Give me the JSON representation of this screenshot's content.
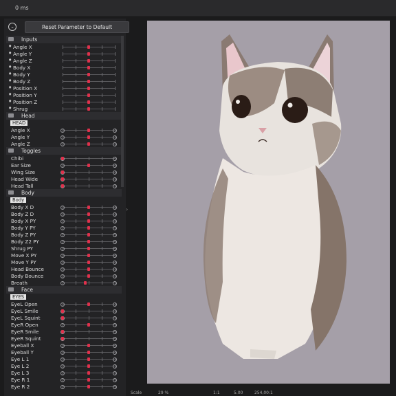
{
  "topbar": {
    "time": "0 ms"
  },
  "toolbar": {
    "reset_label": "Reset Parameter to Default",
    "collapse_icon": "chevron-down-icon"
  },
  "params": [
    {
      "type": "group",
      "label": "Inputs"
    },
    {
      "type": "input",
      "label": "Angle X",
      "value": 0.5
    },
    {
      "type": "input",
      "label": "Angle Y",
      "value": 0.5
    },
    {
      "type": "input",
      "label": "Angle Z",
      "value": 0.5
    },
    {
      "type": "input",
      "label": "Body X",
      "value": 0.5
    },
    {
      "type": "input",
      "label": "Body Y",
      "value": 0.5
    },
    {
      "type": "input",
      "label": "Body Z",
      "value": 0.5
    },
    {
      "type": "input",
      "label": "Position X",
      "value": 0.5
    },
    {
      "type": "input",
      "label": "Position Y",
      "value": 0.5
    },
    {
      "type": "input",
      "label": "Position Z",
      "value": 0.5
    },
    {
      "type": "input",
      "label": "Shrug",
      "value": 0.5
    },
    {
      "type": "group",
      "label": "Head"
    },
    {
      "type": "tag",
      "label": "HEAD"
    },
    {
      "type": "param",
      "label": "Angle X",
      "value": 0.5
    },
    {
      "type": "param",
      "label": "Angle Y",
      "value": 0.5
    },
    {
      "type": "param",
      "label": "Angle Z",
      "value": 0.5
    },
    {
      "type": "group",
      "label": "Toggles"
    },
    {
      "type": "param",
      "label": "Chibi",
      "value": 0.0
    },
    {
      "type": "param",
      "label": "Ear Size",
      "value": 0.5
    },
    {
      "type": "param",
      "label": "Wing Size",
      "value": 0.0
    },
    {
      "type": "param",
      "label": "Head Wide",
      "value": 0.0
    },
    {
      "type": "param",
      "label": "Head Tall",
      "value": 0.0
    },
    {
      "type": "group",
      "label": "Body"
    },
    {
      "type": "tag",
      "label": "Body"
    },
    {
      "type": "param",
      "label": "Body X D",
      "value": 0.5
    },
    {
      "type": "param",
      "label": "Body Z D",
      "value": 0.5
    },
    {
      "type": "param",
      "label": "Body X PY",
      "value": 0.5
    },
    {
      "type": "param",
      "label": "Body Y PY",
      "value": 0.5
    },
    {
      "type": "param",
      "label": "Body Z PY",
      "value": 0.5
    },
    {
      "type": "param",
      "label": "Body Z2 PY",
      "value": 0.5
    },
    {
      "type": "param",
      "label": "Shrug PY",
      "value": 0.5
    },
    {
      "type": "param",
      "label": "Move X PY",
      "value": 0.5
    },
    {
      "type": "param",
      "label": "Move Y PY",
      "value": 0.5
    },
    {
      "type": "param",
      "label": "Head Bounce",
      "value": 0.5
    },
    {
      "type": "param",
      "label": "Body Bounce",
      "value": 0.5
    },
    {
      "type": "param",
      "label": "Breath",
      "value": 0.44
    },
    {
      "type": "group",
      "label": "Face"
    },
    {
      "type": "tag",
      "label": "EYES"
    },
    {
      "type": "param",
      "label": "EyeL Open",
      "value": 0.5
    },
    {
      "type": "param",
      "label": "EyeL Smile",
      "value": 0.0
    },
    {
      "type": "param",
      "label": "EyeL Squint",
      "value": 0.0
    },
    {
      "type": "param",
      "label": "EyeR Open",
      "value": 0.5
    },
    {
      "type": "param",
      "label": "EyeR Smile",
      "value": 0.0
    },
    {
      "type": "param",
      "label": "EyeR Squint",
      "value": 0.0
    },
    {
      "type": "param",
      "label": "Eyeball X",
      "value": 0.5
    },
    {
      "type": "param",
      "label": "Eyeball Y",
      "value": 0.5
    },
    {
      "type": "param",
      "label": "Eye L 1",
      "value": 0.5
    },
    {
      "type": "param",
      "label": "Eye L 2",
      "value": 0.5
    },
    {
      "type": "param",
      "label": "Eye L 3",
      "value": 0.5
    },
    {
      "type": "param",
      "label": "Eye R 1",
      "value": 0.5
    },
    {
      "type": "param",
      "label": "Eye R 2",
      "value": 0.5
    }
  ],
  "statusbar": {
    "scale_label": "Scale",
    "zoom": "29 %",
    "coords": "1:1",
    "fps": "5.00",
    "extra": "254,00:1"
  },
  "colors": {
    "accent": "#e0314c",
    "canvas_bg": "#a59fa8",
    "panel_bg": "#232325"
  }
}
